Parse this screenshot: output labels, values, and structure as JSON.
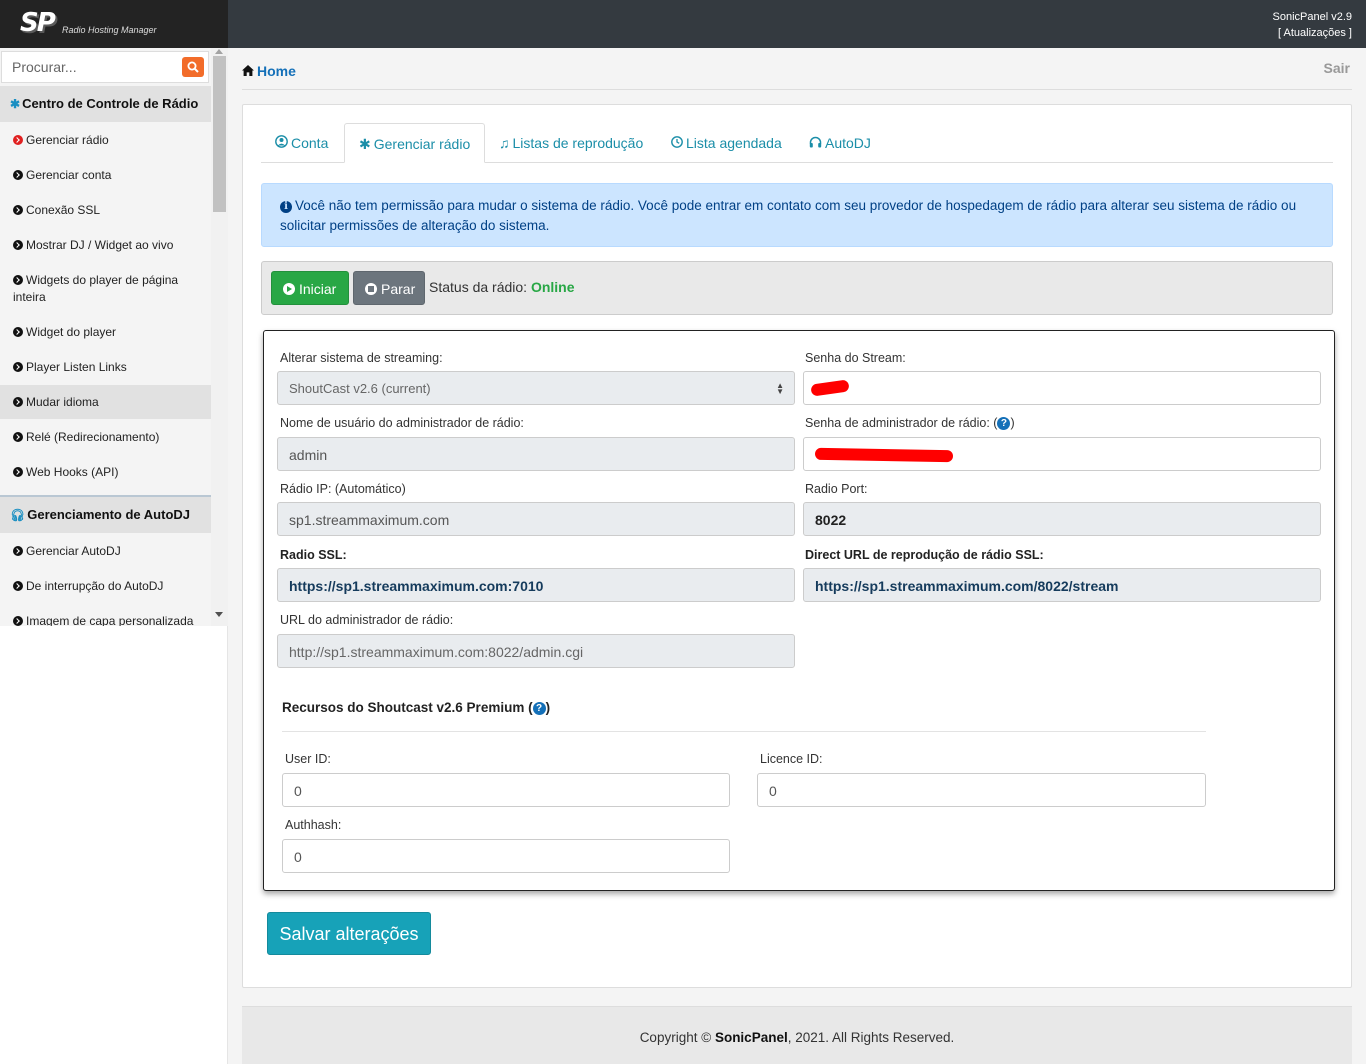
{
  "header": {
    "logo_mark": "SP",
    "logo_subtitle": "Radio Hosting Manager",
    "version": "SonicPanel v2.9",
    "updates_link": "[ Atualizações ]"
  },
  "sidebar": {
    "search_placeholder": "Procurar...",
    "sections": [
      {
        "title": "Centro de Controle de Rádio",
        "icon": "gear-icon",
        "items": [
          {
            "label": "Gerenciar rádio",
            "active": true
          },
          {
            "label": "Gerenciar conta"
          },
          {
            "label": "Conexão SSL"
          },
          {
            "label": "Mostrar DJ / Widget ao vivo"
          },
          {
            "label": "Widgets do player de página inteira"
          },
          {
            "label": "Widget do player"
          },
          {
            "label": "Player Listen Links"
          },
          {
            "label": "Mudar idioma",
            "hover": true
          },
          {
            "label": "Relé (Redirecionamento)"
          },
          {
            "label": "Web Hooks (API)"
          }
        ]
      },
      {
        "title": "Gerenciamento de AutoDJ",
        "icon": "headphones-icon",
        "items": [
          {
            "label": "Gerenciar AutoDJ"
          },
          {
            "label": "De interrupção do AutoDJ"
          },
          {
            "label": "Imagem de capa personalizada"
          }
        ]
      }
    ]
  },
  "breadcrumb": {
    "home": "Home"
  },
  "logout": "Sair",
  "tabs": [
    {
      "label": "Conta",
      "icon": "user-circle-icon"
    },
    {
      "label": "Gerenciar rádio",
      "icon": "gear-icon",
      "active": true
    },
    {
      "label": "Listas de reprodução",
      "icon": "music-note-icon"
    },
    {
      "label": "Lista agendada",
      "icon": "clock-icon"
    },
    {
      "label": "AutoDJ",
      "icon": "headphones-icon"
    }
  ],
  "alert": {
    "text": "Você não tem permissão para mudar o sistema de rádio. Você pode entrar em contato com seu provedor de hospedagem de rádio para alterar seu sistema de rádio ou solicitar permissões de alteração do sistema."
  },
  "controls": {
    "start_label": "Iniciar",
    "stop_label": "Parar",
    "status_label": "Status da rádio:",
    "status_value": "Online"
  },
  "form": {
    "streaming_system": {
      "label": "Alterar sistema de streaming:",
      "value": "ShoutCast v2.6 (current)"
    },
    "stream_password": {
      "label": "Senha do Stream:",
      "value": ""
    },
    "admin_username": {
      "label": "Nome de usuário do administrador de rádio:",
      "value": "admin"
    },
    "admin_password": {
      "label": "Senha de administrador de rádio: (",
      "label_end": ")",
      "help": "?",
      "value": ""
    },
    "radio_ip": {
      "label": "Rádio IP: (Automático)",
      "value": "sp1.streammaximum.com"
    },
    "radio_port": {
      "label": "Radio Port:",
      "value": "8022"
    },
    "radio_ssl": {
      "label": "Radio SSL:",
      "value": "https://sp1.streammaximum.com:7010"
    },
    "direct_url": {
      "label": "Direct URL de reprodução de rádio SSL:",
      "value": "https://sp1.streammaximum.com/8022/stream"
    },
    "admin_url": {
      "label": "URL do administrador de rádio:",
      "value": "http://sp1.streammaximum.com:8022/admin.cgi"
    }
  },
  "premium": {
    "title": "Recursos do Shoutcast v2.6 Premium (",
    "title_end": ")",
    "help": "?",
    "user_id": {
      "label": "User ID:",
      "value": "0"
    },
    "licence_id": {
      "label": "Licence ID:",
      "value": "0"
    },
    "authhash": {
      "label": "Authhash:",
      "value": "0"
    }
  },
  "save_label": "Salvar alterações",
  "footer": {
    "prefix": "Copyright ©",
    "brand": "SonicPanel",
    "suffix": ", 2021. All Rights Reserved."
  },
  "colors": {
    "topbar": "#343a40",
    "accent_link": "#1470b8",
    "tab_text": "#1b8ea8",
    "online": "#28a745",
    "save_button": "#17a2b8",
    "redaction": "#ff0000"
  }
}
